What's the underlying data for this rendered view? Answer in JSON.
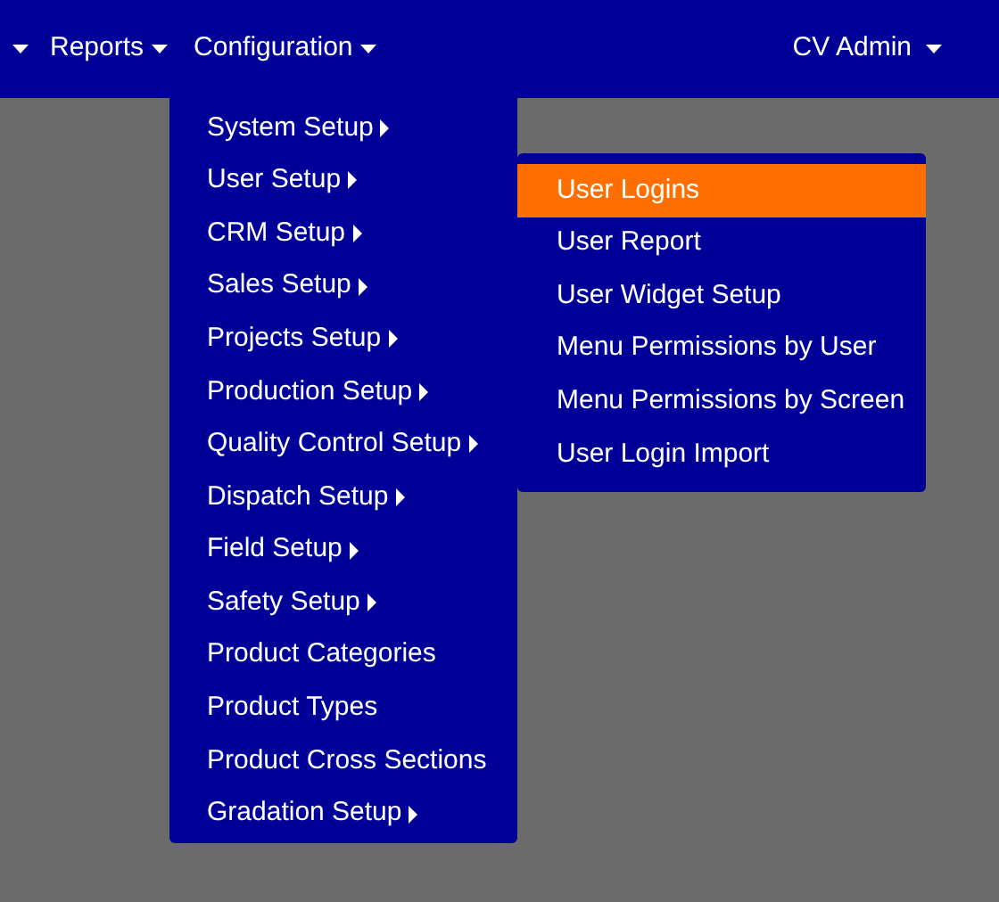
{
  "navbar": {
    "menus": [
      {
        "label": "Reports"
      },
      {
        "label": "Configuration"
      }
    ],
    "user": {
      "label": "CV Admin"
    }
  },
  "config_menu": {
    "items": [
      {
        "label": "System Setup",
        "has_submenu": true
      },
      {
        "label": "User Setup",
        "has_submenu": true
      },
      {
        "label": "CRM Setup",
        "has_submenu": true
      },
      {
        "label": "Sales Setup",
        "has_submenu": true
      },
      {
        "label": "Projects Setup",
        "has_submenu": true
      },
      {
        "label": "Production Setup",
        "has_submenu": true
      },
      {
        "label": "Quality Control Setup",
        "has_submenu": true
      },
      {
        "label": "Dispatch Setup",
        "has_submenu": true
      },
      {
        "label": "Field Setup",
        "has_submenu": true
      },
      {
        "label": "Safety Setup",
        "has_submenu": true
      },
      {
        "label": "Product Categories",
        "has_submenu": false
      },
      {
        "label": "Product Types",
        "has_submenu": false
      },
      {
        "label": "Product Cross Sections",
        "has_submenu": false
      },
      {
        "label": "Gradation Setup",
        "has_submenu": true
      }
    ]
  },
  "user_submenu": {
    "items": [
      {
        "label": "User Logins",
        "selected": true
      },
      {
        "label": "User Report",
        "selected": false
      },
      {
        "label": "User Widget Setup",
        "selected": false
      },
      {
        "label": "Menu Permissions by User",
        "selected": false
      },
      {
        "label": "Menu Permissions by Screen",
        "selected": false
      },
      {
        "label": "User Login Import",
        "selected": false
      }
    ]
  }
}
